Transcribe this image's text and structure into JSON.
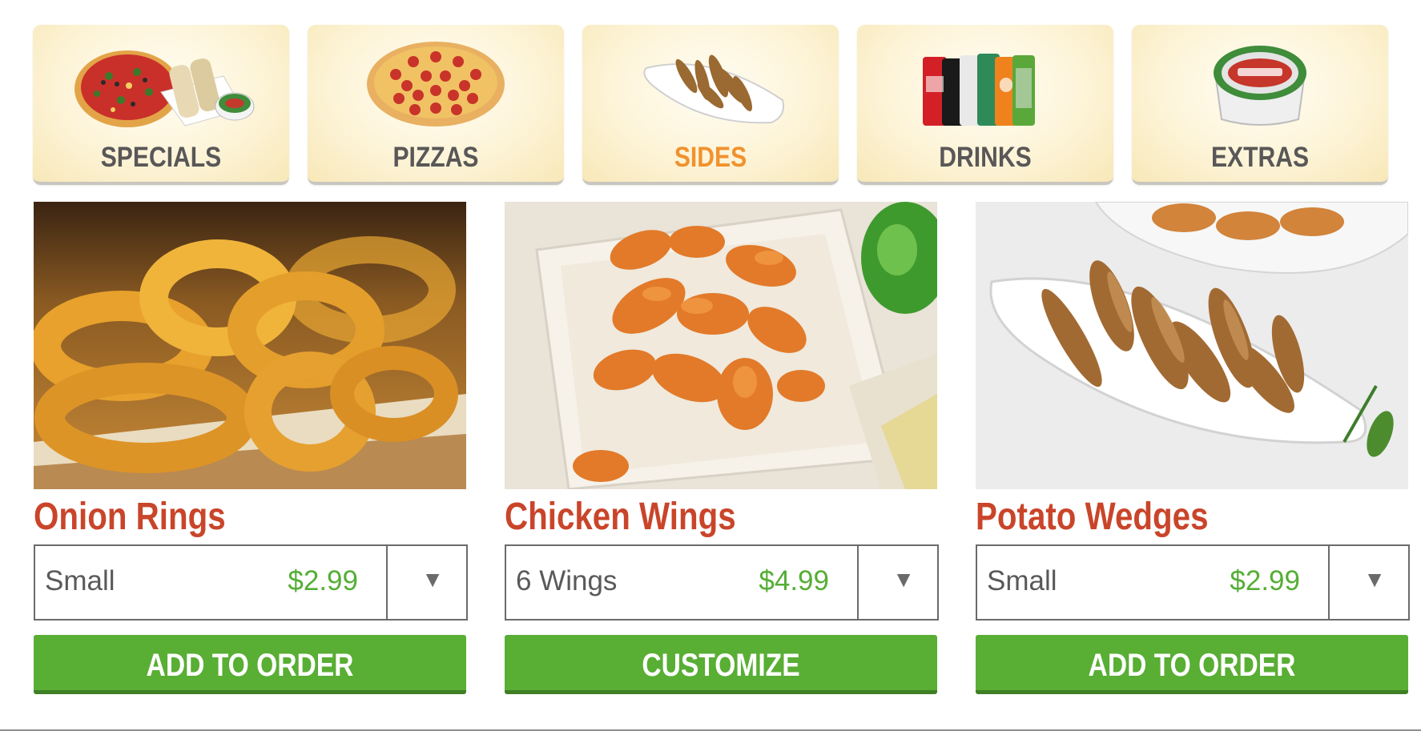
{
  "categories": [
    {
      "label": "SPECIALS",
      "icon": "pizza-with-breadsticks-icon",
      "active": false
    },
    {
      "label": "PIZZAS",
      "icon": "pepperoni-pizza-icon",
      "active": false
    },
    {
      "label": "SIDES",
      "icon": "potato-wedges-dish-icon",
      "active": true
    },
    {
      "label": "DRINKS",
      "icon": "soda-cans-icon",
      "active": false
    },
    {
      "label": "EXTRAS",
      "icon": "dipping-sauce-cup-icon",
      "active": false
    }
  ],
  "products": [
    {
      "name": "Onion Rings",
      "size": "Small",
      "price": "$2.99",
      "button": "ADD TO ORDER",
      "photo": "onion-rings-photo"
    },
    {
      "name": "Chicken Wings",
      "size": "6 Wings",
      "price": "$4.99",
      "button": "CUSTOMIZE",
      "photo": "chicken-wings-photo"
    },
    {
      "name": "Potato Wedges",
      "size": "Small",
      "price": "$2.99",
      "button": "ADD TO ORDER",
      "photo": "potato-wedges-photo"
    }
  ],
  "dropdown_arrow": "▼",
  "colors": {
    "active_tab": "#f0922e",
    "product_name": "#c9452a",
    "price": "#55ae36",
    "button": "#59ae34"
  }
}
